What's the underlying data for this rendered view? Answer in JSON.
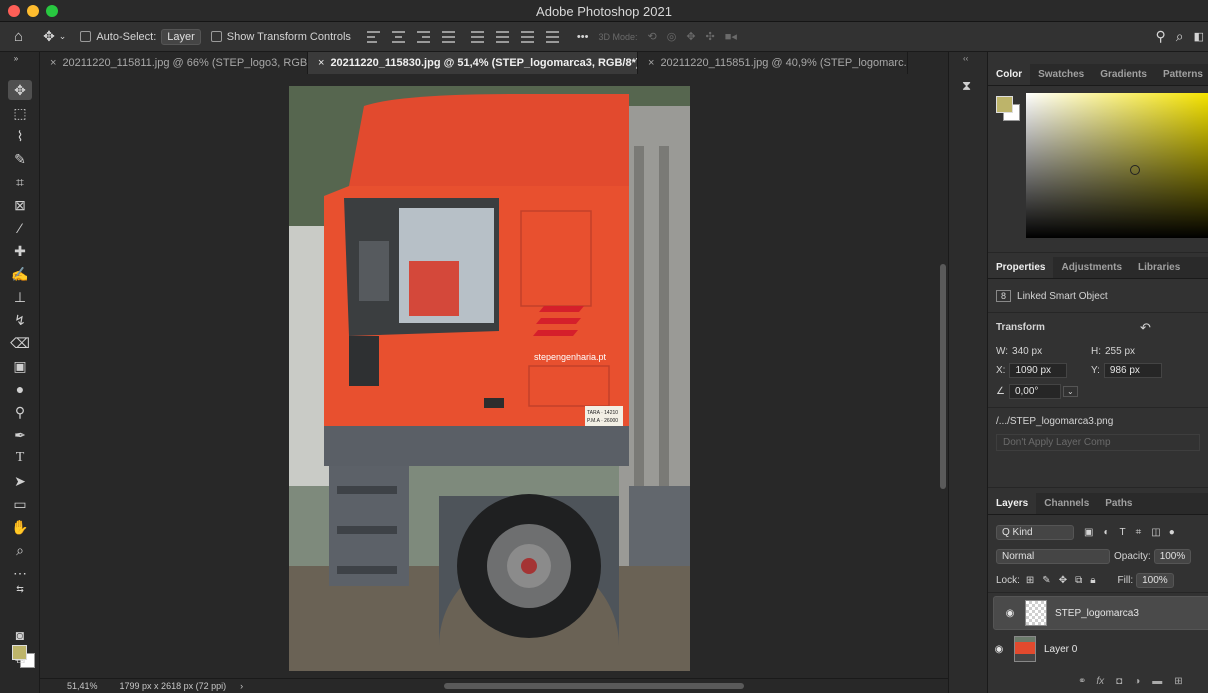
{
  "window": {
    "title": "Adobe Photoshop 2021"
  },
  "options_bar": {
    "auto_select_label": "Auto-Select:",
    "auto_select_value": "Layer",
    "show_transform_label": "Show Transform Controls",
    "more_label": "•••",
    "mode_3d_label": "3D Mode:"
  },
  "tabs": [
    {
      "label": "20211220_115811.jpg @ 66% (STEP_logo3, RGB..."
    },
    {
      "label": "20211220_115830.jpg @ 51,4% (STEP_logomarca3, RGB/8*) *"
    },
    {
      "label": "20211220_115851.jpg @ 40,9% (STEP_logomarc..."
    }
  ],
  "image": {
    "truck_text": "stepengenharia.pt",
    "plate_text_1": "TARA · 14210",
    "plate_text_2": "P.M.A · 26000"
  },
  "status": {
    "zoom": "51,41%",
    "doc_info": "1799 px x 2618 px (72 ppi)",
    "arrow": "›"
  },
  "color_panel": {
    "tabs": [
      "Color",
      "Swatches",
      "Gradients",
      "Patterns"
    ],
    "foreground": "#bdb46a",
    "background": "#ffffff"
  },
  "properties_panel": {
    "tabs": [
      "Properties",
      "Adjustments",
      "Libraries"
    ],
    "object_type": "Linked Smart Object",
    "transform_heading": "Transform",
    "w_label": "W:",
    "w_value": "340 px",
    "h_label": "H:",
    "h_value": "255 px",
    "x_label": "X:",
    "x_value": "1090 px",
    "y_label": "Y:",
    "y_value": "986 px",
    "angle_value": "0,00°",
    "linked_file": "/.../STEP_logomarca3.png",
    "layer_comp_placeholder": "Don't Apply Layer Comp"
  },
  "layers_panel": {
    "tabs": [
      "Layers",
      "Channels",
      "Paths"
    ],
    "filter_label": "Q Kind",
    "blend_mode": "Normal",
    "opacity_label": "Opacity:",
    "opacity_value": "100%",
    "lock_label": "Lock:",
    "fill_label": "Fill:",
    "fill_value": "100%",
    "layers": [
      {
        "name": "STEP_logomarca3",
        "selected": true
      },
      {
        "name": "Layer 0",
        "selected": false
      }
    ],
    "footer_fx": "fx"
  }
}
